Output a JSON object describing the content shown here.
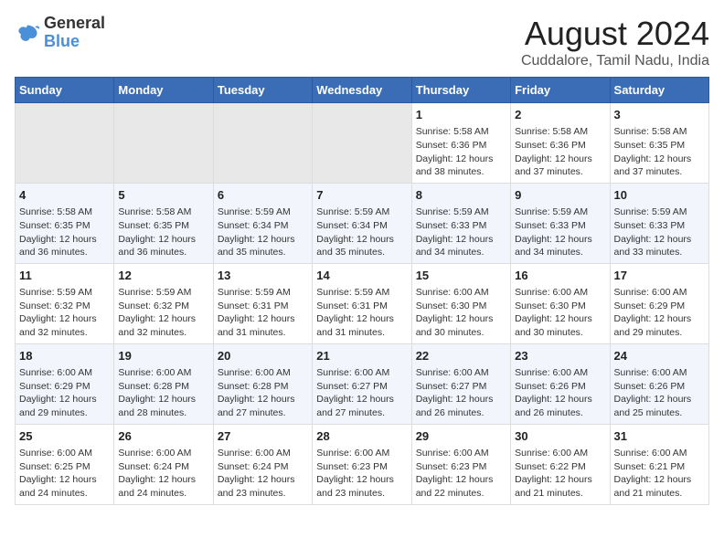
{
  "header": {
    "logo_line1": "General",
    "logo_line2": "Blue",
    "title": "August 2024",
    "subtitle": "Cuddalore, Tamil Nadu, India"
  },
  "weekdays": [
    "Sunday",
    "Monday",
    "Tuesday",
    "Wednesday",
    "Thursday",
    "Friday",
    "Saturday"
  ],
  "weeks": [
    [
      {
        "day": "",
        "empty": true
      },
      {
        "day": "",
        "empty": true
      },
      {
        "day": "",
        "empty": true
      },
      {
        "day": "",
        "empty": true
      },
      {
        "day": "1",
        "sunrise": "5:58 AM",
        "sunset": "6:36 PM",
        "daylight": "12 hours and 38 minutes."
      },
      {
        "day": "2",
        "sunrise": "5:58 AM",
        "sunset": "6:36 PM",
        "daylight": "12 hours and 37 minutes."
      },
      {
        "day": "3",
        "sunrise": "5:58 AM",
        "sunset": "6:35 PM",
        "daylight": "12 hours and 37 minutes."
      }
    ],
    [
      {
        "day": "4",
        "sunrise": "5:58 AM",
        "sunset": "6:35 PM",
        "daylight": "12 hours and 36 minutes."
      },
      {
        "day": "5",
        "sunrise": "5:58 AM",
        "sunset": "6:35 PM",
        "daylight": "12 hours and 36 minutes."
      },
      {
        "day": "6",
        "sunrise": "5:59 AM",
        "sunset": "6:34 PM",
        "daylight": "12 hours and 35 minutes."
      },
      {
        "day": "7",
        "sunrise": "5:59 AM",
        "sunset": "6:34 PM",
        "daylight": "12 hours and 35 minutes."
      },
      {
        "day": "8",
        "sunrise": "5:59 AM",
        "sunset": "6:33 PM",
        "daylight": "12 hours and 34 minutes."
      },
      {
        "day": "9",
        "sunrise": "5:59 AM",
        "sunset": "6:33 PM",
        "daylight": "12 hours and 34 minutes."
      },
      {
        "day": "10",
        "sunrise": "5:59 AM",
        "sunset": "6:33 PM",
        "daylight": "12 hours and 33 minutes."
      }
    ],
    [
      {
        "day": "11",
        "sunrise": "5:59 AM",
        "sunset": "6:32 PM",
        "daylight": "12 hours and 32 minutes."
      },
      {
        "day": "12",
        "sunrise": "5:59 AM",
        "sunset": "6:32 PM",
        "daylight": "12 hours and 32 minutes."
      },
      {
        "day": "13",
        "sunrise": "5:59 AM",
        "sunset": "6:31 PM",
        "daylight": "12 hours and 31 minutes."
      },
      {
        "day": "14",
        "sunrise": "5:59 AM",
        "sunset": "6:31 PM",
        "daylight": "12 hours and 31 minutes."
      },
      {
        "day": "15",
        "sunrise": "6:00 AM",
        "sunset": "6:30 PM",
        "daylight": "12 hours and 30 minutes."
      },
      {
        "day": "16",
        "sunrise": "6:00 AM",
        "sunset": "6:30 PM",
        "daylight": "12 hours and 30 minutes."
      },
      {
        "day": "17",
        "sunrise": "6:00 AM",
        "sunset": "6:29 PM",
        "daylight": "12 hours and 29 minutes."
      }
    ],
    [
      {
        "day": "18",
        "sunrise": "6:00 AM",
        "sunset": "6:29 PM",
        "daylight": "12 hours and 29 minutes."
      },
      {
        "day": "19",
        "sunrise": "6:00 AM",
        "sunset": "6:28 PM",
        "daylight": "12 hours and 28 minutes."
      },
      {
        "day": "20",
        "sunrise": "6:00 AM",
        "sunset": "6:28 PM",
        "daylight": "12 hours and 27 minutes."
      },
      {
        "day": "21",
        "sunrise": "6:00 AM",
        "sunset": "6:27 PM",
        "daylight": "12 hours and 27 minutes."
      },
      {
        "day": "22",
        "sunrise": "6:00 AM",
        "sunset": "6:27 PM",
        "daylight": "12 hours and 26 minutes."
      },
      {
        "day": "23",
        "sunrise": "6:00 AM",
        "sunset": "6:26 PM",
        "daylight": "12 hours and 26 minutes."
      },
      {
        "day": "24",
        "sunrise": "6:00 AM",
        "sunset": "6:26 PM",
        "daylight": "12 hours and 25 minutes."
      }
    ],
    [
      {
        "day": "25",
        "sunrise": "6:00 AM",
        "sunset": "6:25 PM",
        "daylight": "12 hours and 24 minutes."
      },
      {
        "day": "26",
        "sunrise": "6:00 AM",
        "sunset": "6:24 PM",
        "daylight": "12 hours and 24 minutes."
      },
      {
        "day": "27",
        "sunrise": "6:00 AM",
        "sunset": "6:24 PM",
        "daylight": "12 hours and 23 minutes."
      },
      {
        "day": "28",
        "sunrise": "6:00 AM",
        "sunset": "6:23 PM",
        "daylight": "12 hours and 23 minutes."
      },
      {
        "day": "29",
        "sunrise": "6:00 AM",
        "sunset": "6:23 PM",
        "daylight": "12 hours and 22 minutes."
      },
      {
        "day": "30",
        "sunrise": "6:00 AM",
        "sunset": "6:22 PM",
        "daylight": "12 hours and 21 minutes."
      },
      {
        "day": "31",
        "sunrise": "6:00 AM",
        "sunset": "6:21 PM",
        "daylight": "12 hours and 21 minutes."
      }
    ]
  ]
}
